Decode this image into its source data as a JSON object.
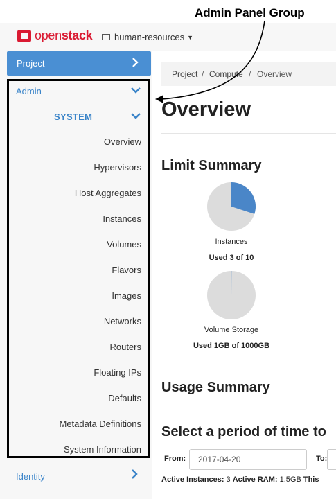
{
  "annotation": {
    "label": "Admin Panel Group"
  },
  "navbar": {
    "brand_open": "open",
    "brand_stack": "stack",
    "project": "human-resources",
    "brand_color": "#da1a32"
  },
  "sidebar": {
    "project_label": "Project",
    "admin_label": "Admin",
    "system_label": "SYSTEM",
    "items": [
      "Overview",
      "Hypervisors",
      "Host Aggregates",
      "Instances",
      "Volumes",
      "Flavors",
      "Images",
      "Networks",
      "Routers",
      "Floating IPs",
      "Defaults",
      "Metadata Definitions",
      "System Information"
    ],
    "identity_label": "Identity",
    "accent_color": "#4a8fd3"
  },
  "breadcrumb": [
    "Project",
    "Compute",
    "Overview"
  ],
  "page_title": "Overview",
  "limit_summary": {
    "heading": "Limit Summary",
    "instances": {
      "label": "Instances",
      "used_text": "Used 3 of 10",
      "used": 3,
      "total": 10
    },
    "volume_storage": {
      "label": "Volume Storage",
      "used_text": "Used 1GB of 1000GB",
      "used": 1,
      "total": 1000
    }
  },
  "usage_summary": {
    "heading": "Usage Summary"
  },
  "period": {
    "heading": "Select a period of time to",
    "from_label": "From:",
    "from_value": "2017-04-20",
    "to_label": "To:"
  },
  "active": {
    "instances_label": "Active Instances:",
    "instances_value": "3",
    "ram_label": "Active RAM:",
    "ram_value": "1.5GB",
    "this_label": "This"
  }
}
